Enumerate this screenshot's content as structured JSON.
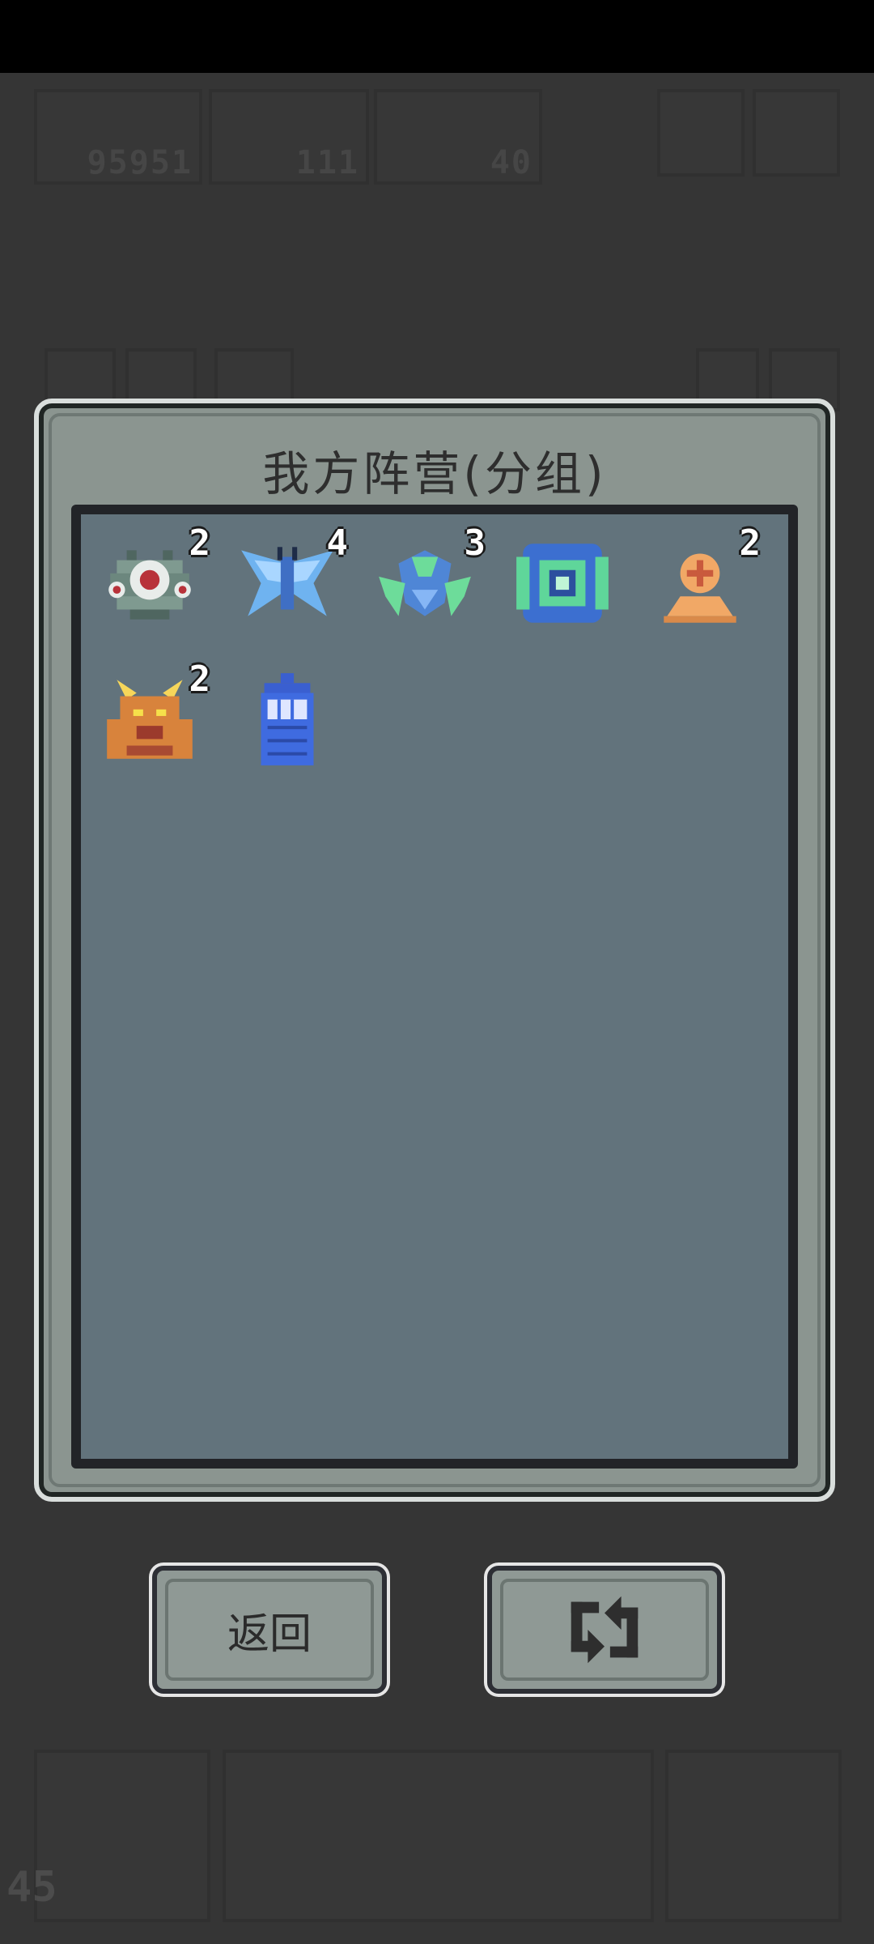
{
  "hud": {
    "coins": "95951",
    "gems": "111",
    "crosses": "40",
    "bottom_count": "45"
  },
  "dialog": {
    "title": "我方阵营(分组)"
  },
  "units": [
    {
      "name": "eye-robot",
      "count": "2"
    },
    {
      "name": "ice-moth",
      "count": "4"
    },
    {
      "name": "mantis-bug",
      "count": "3"
    },
    {
      "name": "shield-core",
      "count": ""
    },
    {
      "name": "orange-bust",
      "count": "2"
    },
    {
      "name": "horned-beast",
      "count": "2"
    },
    {
      "name": "blue-booth",
      "count": ""
    }
  ],
  "buttons": {
    "back_label": "返回",
    "swap_icon": "swap-arrows-icon"
  }
}
